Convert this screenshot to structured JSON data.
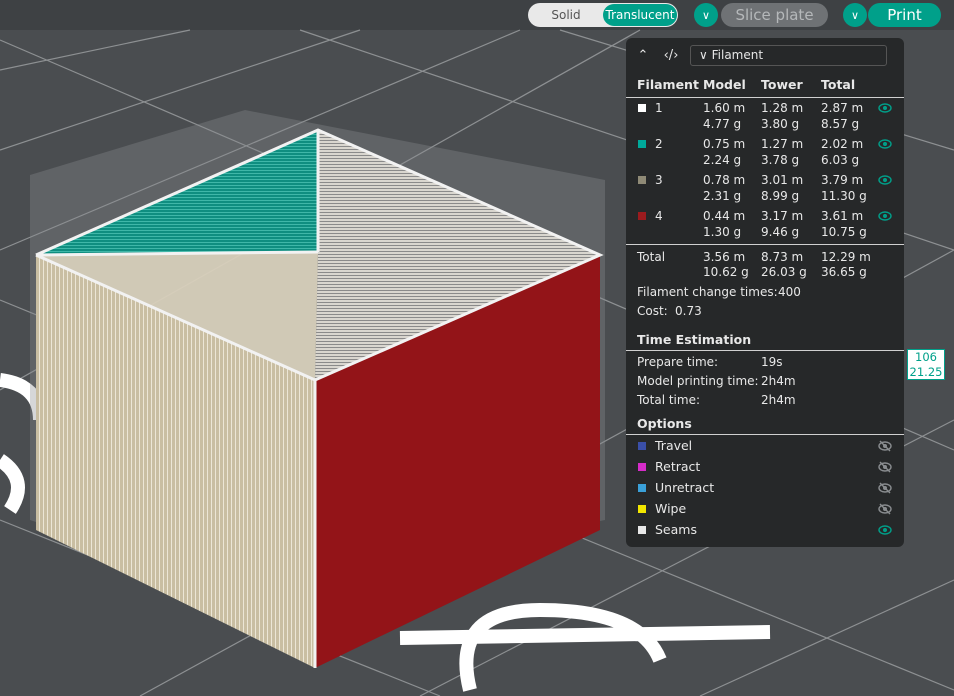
{
  "toolbar": {
    "view_modes": [
      {
        "label": "Solid",
        "active": false
      },
      {
        "label": "Translucent",
        "active": true
      }
    ],
    "slice_label": "Slice plate",
    "print_label": "Print",
    "accent_color": "#00a08a"
  },
  "panel": {
    "view_select": "Filament",
    "columns": [
      "Filament",
      "Model",
      "Tower",
      "Total"
    ],
    "filaments": [
      {
        "id": "1",
        "color": "#ffffff",
        "model_m": "1.60 m",
        "model_g": "4.77 g",
        "tower_m": "1.28 m",
        "tower_g": "3.80 g",
        "total_m": "2.87 m",
        "total_g": "8.57 g"
      },
      {
        "id": "2",
        "color": "#00a99a",
        "model_m": "0.75 m",
        "model_g": "2.24 g",
        "tower_m": "1.27 m",
        "tower_g": "3.78 g",
        "total_m": "2.02 m",
        "total_g": "6.03 g"
      },
      {
        "id": "3",
        "color": "#8f8a76",
        "model_m": "0.78 m",
        "model_g": "2.31 g",
        "tower_m": "3.01 m",
        "tower_g": "8.99 g",
        "total_m": "3.79 m",
        "total_g": "11.30 g"
      },
      {
        "id": "4",
        "color": "#9b1b1e",
        "model_m": "0.44 m",
        "model_g": "1.30 g",
        "tower_m": "3.17 m",
        "tower_g": "9.46 g",
        "total_m": "3.61 m",
        "total_g": "10.75 g"
      }
    ],
    "total": {
      "label": "Total",
      "model_m": "3.56 m",
      "model_g": "10.62 g",
      "tower_m": "8.73 m",
      "tower_g": "26.03 g",
      "total_m": "12.29 m",
      "total_g": "36.65 g"
    },
    "change_times_label": "Filament change times:",
    "change_times_value": "400",
    "cost_label": "Cost:",
    "cost_value": "0.73",
    "time_title": "Time Estimation",
    "prepare_label": "Prepare time:",
    "prepare_value": "19s",
    "model_time_label": "Model printing time:",
    "model_time_value": "2h4m",
    "total_time_label": "Total time:",
    "total_time_value": "2h4m",
    "options_title": "Options",
    "options": [
      {
        "label": "Travel",
        "color": "#3a4fa8",
        "visible": false
      },
      {
        "label": "Retract",
        "color": "#d62cc9",
        "visible": false
      },
      {
        "label": "Unretract",
        "color": "#3aa0d8",
        "visible": false
      },
      {
        "label": "Wipe",
        "color": "#f2e600",
        "visible": false
      },
      {
        "label": "Seams",
        "color": "#e8e8e8",
        "visible": true
      }
    ]
  },
  "layer_ruler": {
    "layer": "106",
    "height": "21.25"
  }
}
